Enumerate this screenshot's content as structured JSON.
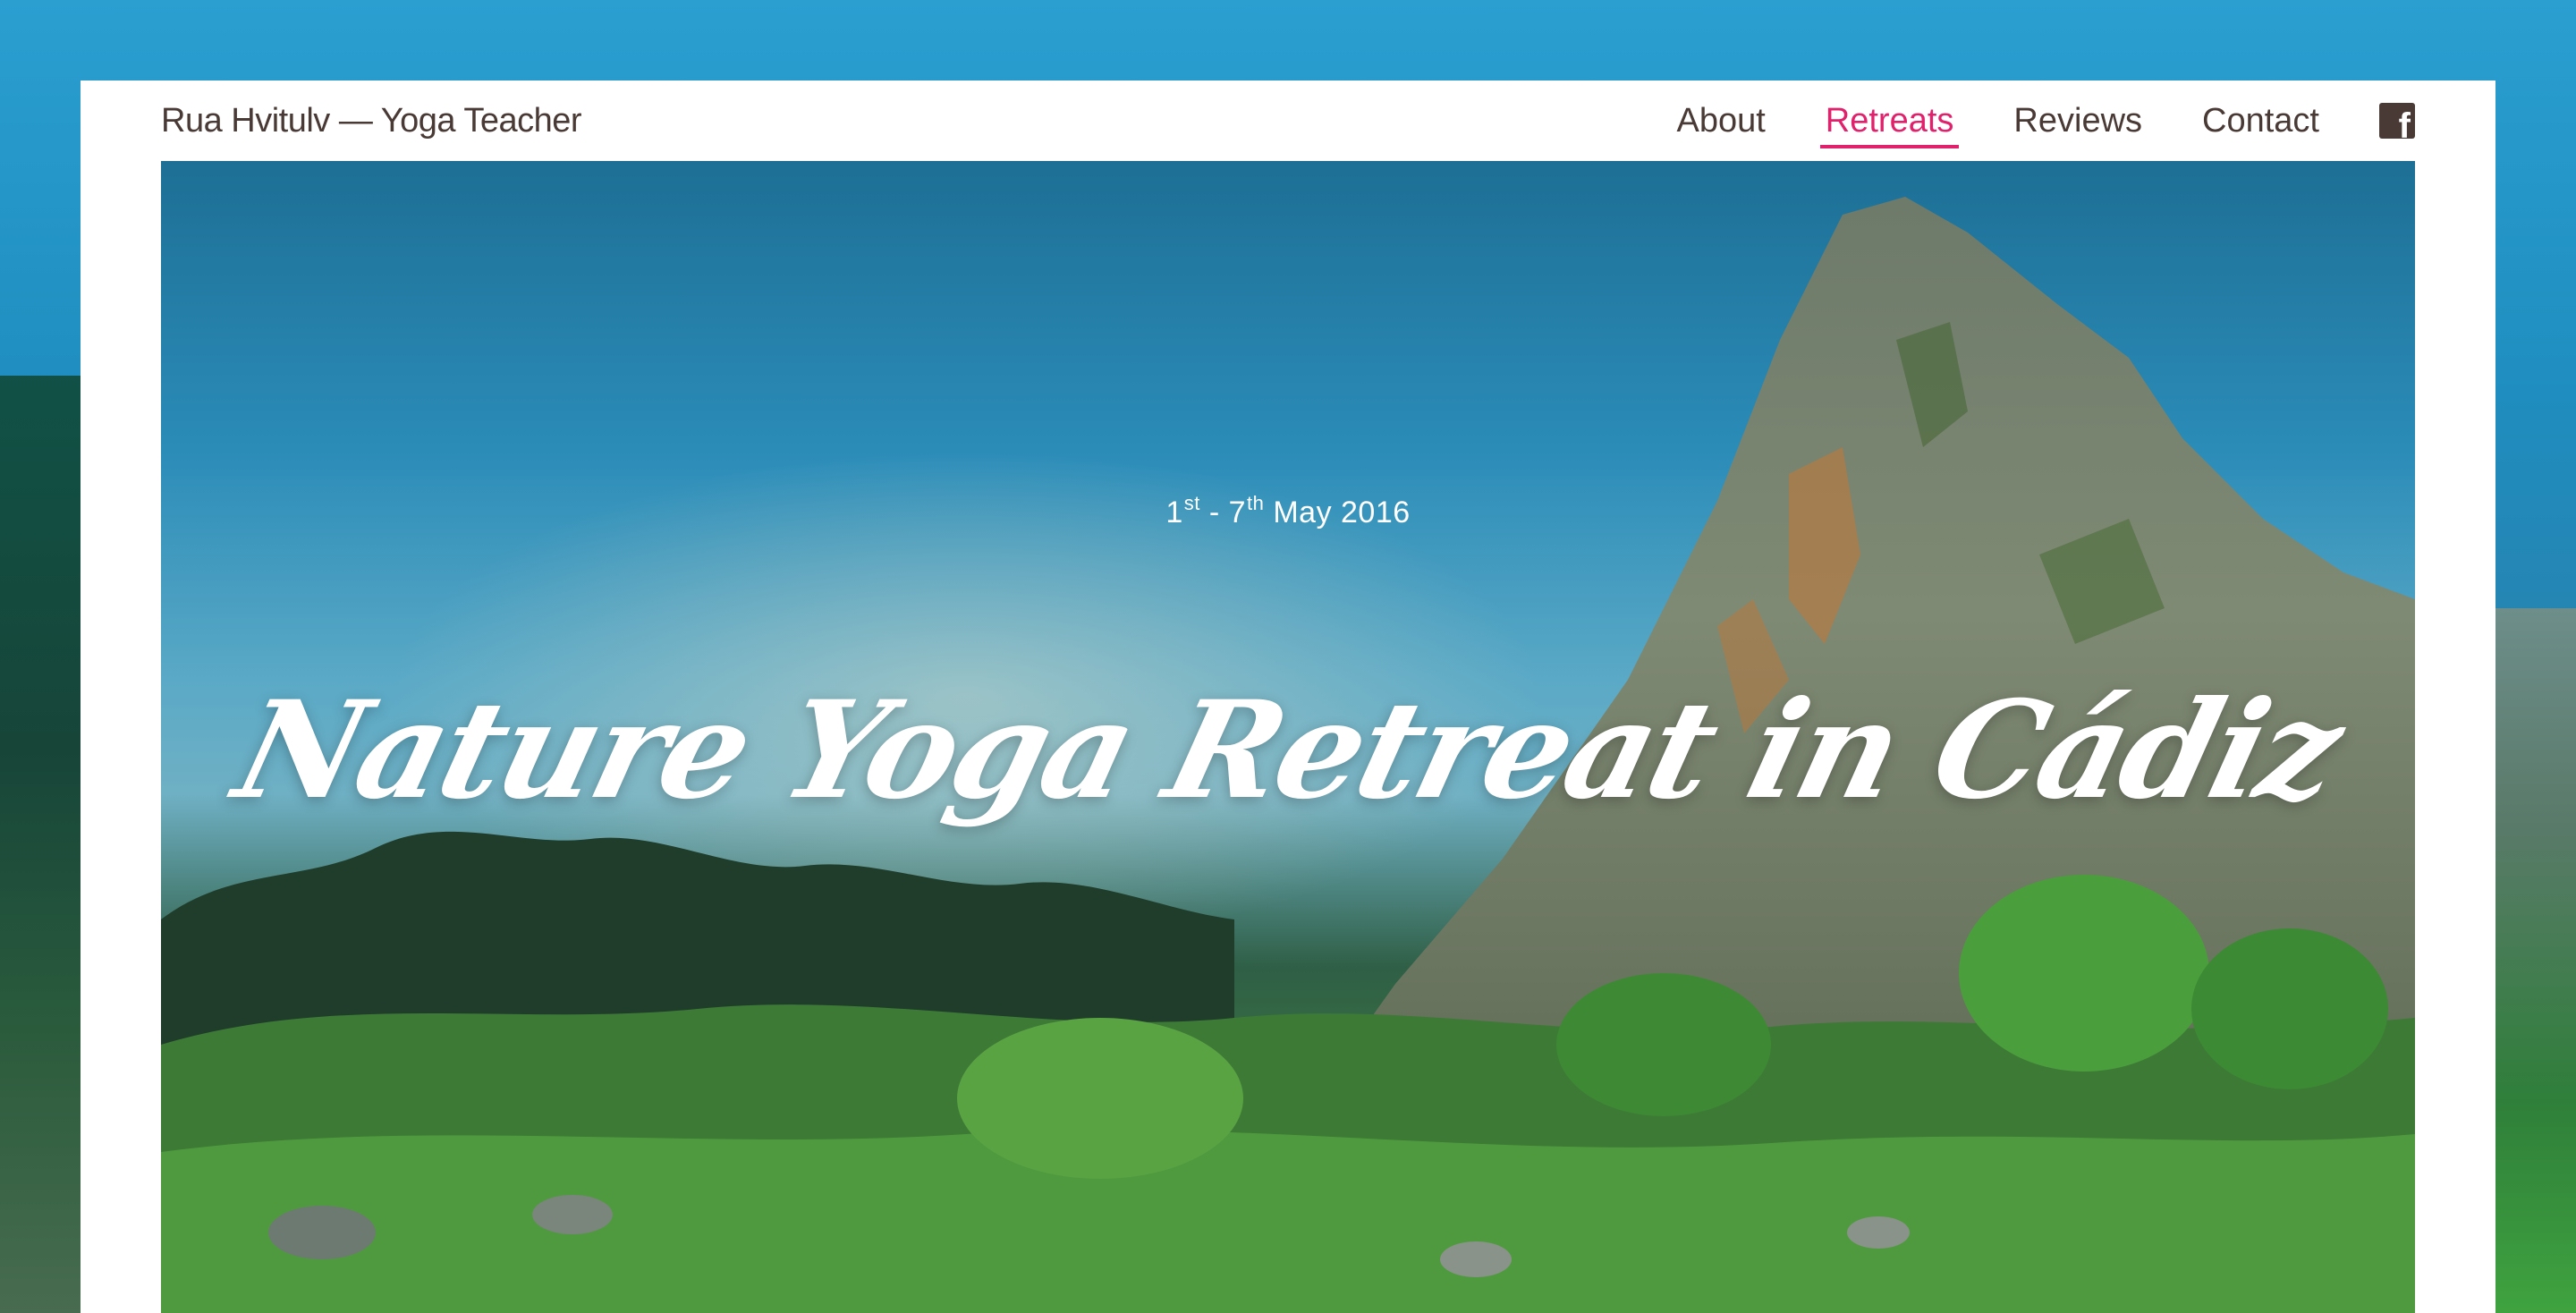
{
  "header": {
    "brand": "Rua Hvitulv — Yoga Teacher",
    "nav": [
      {
        "label": "About",
        "active": false
      },
      {
        "label": "Retreats",
        "active": true
      },
      {
        "label": "Reviews",
        "active": false
      },
      {
        "label": "Contact",
        "active": false
      }
    ],
    "social_icon": "facebook-icon",
    "accent_color": "#e0216b",
    "text_color": "#4a3a35"
  },
  "hero": {
    "date_start_day": "1",
    "date_start_suffix": "st",
    "date_separator": " - ",
    "date_end_day": "7",
    "date_end_suffix": "th",
    "date_month_year": " May 2016",
    "title": "Nature Yoga Retreat in Cádiz"
  }
}
